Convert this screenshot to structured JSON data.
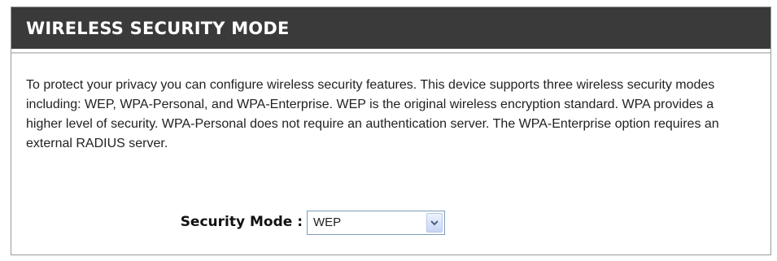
{
  "section": {
    "title": "WIRELESS SECURITY MODE",
    "description": "To protect your privacy you can configure wireless security features. This device supports three wireless security modes including: WEP, WPA-Personal, and WPA-Enterprise. WEP is the original wireless encryption standard. WPA provides a higher level of security. WPA-Personal does not require an authentication server. The WPA-Enterprise option requires an external RADIUS server."
  },
  "form": {
    "security_mode_label": "Security Mode :",
    "security_mode_value": "WEP"
  },
  "colors": {
    "header_background": "#3a3a3a",
    "header_text": "#ffffff",
    "dropdown_arrow": "#4d6185"
  },
  "icons": {
    "dropdown": "chevron-down-icon"
  }
}
